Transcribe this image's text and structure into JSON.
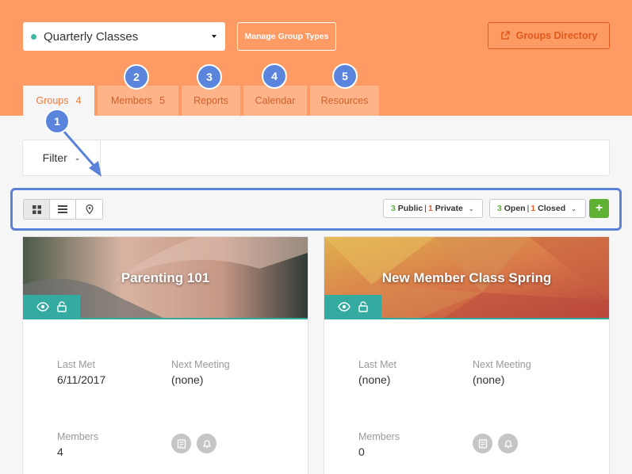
{
  "header": {
    "group_type_selected": "Quarterly Classes",
    "manage_group_types_label": "Manage Group Types",
    "groups_directory_label": "Groups Directory"
  },
  "tabs": [
    {
      "label": "Groups",
      "count": "4",
      "active": true
    },
    {
      "label": "Members",
      "count": "5",
      "active": false
    },
    {
      "label": "Reports",
      "count": "",
      "active": false
    },
    {
      "label": "Calendar",
      "count": "",
      "active": false
    },
    {
      "label": "Resources",
      "count": "",
      "active": false
    }
  ],
  "callouts": [
    "1",
    "2",
    "3",
    "4",
    "5"
  ],
  "filter": {
    "label": "Filter",
    "value": ""
  },
  "toolbar": {
    "view_modes": [
      "grid-icon",
      "list-icon",
      "map-pin-icon"
    ],
    "visibility": {
      "public_count": "3",
      "public_label": "Public",
      "private_count": "1",
      "private_label": "Private"
    },
    "status": {
      "open_count": "3",
      "open_label": "Open",
      "closed_count": "1",
      "closed_label": "Closed"
    },
    "add_label": "+"
  },
  "groups": [
    {
      "title": "Parenting 101",
      "last_met_label": "Last Met",
      "last_met": "6/11/2017",
      "next_meeting_label": "Next Meeting",
      "next_meeting": "(none)",
      "members_label": "Members",
      "members": "4"
    },
    {
      "title": "New Member Class Spring",
      "last_met_label": "Last Met",
      "last_met": "(none)",
      "next_meeting_label": "Next Meeting",
      "next_meeting": "(none)",
      "members_label": "Members",
      "members": "0"
    }
  ],
  "colors": {
    "header_bg": "#fe9a63",
    "accent_teal": "#33aba0",
    "callout_blue": "#5b85dd",
    "green": "#5fb134",
    "orange": "#e85d2d"
  }
}
